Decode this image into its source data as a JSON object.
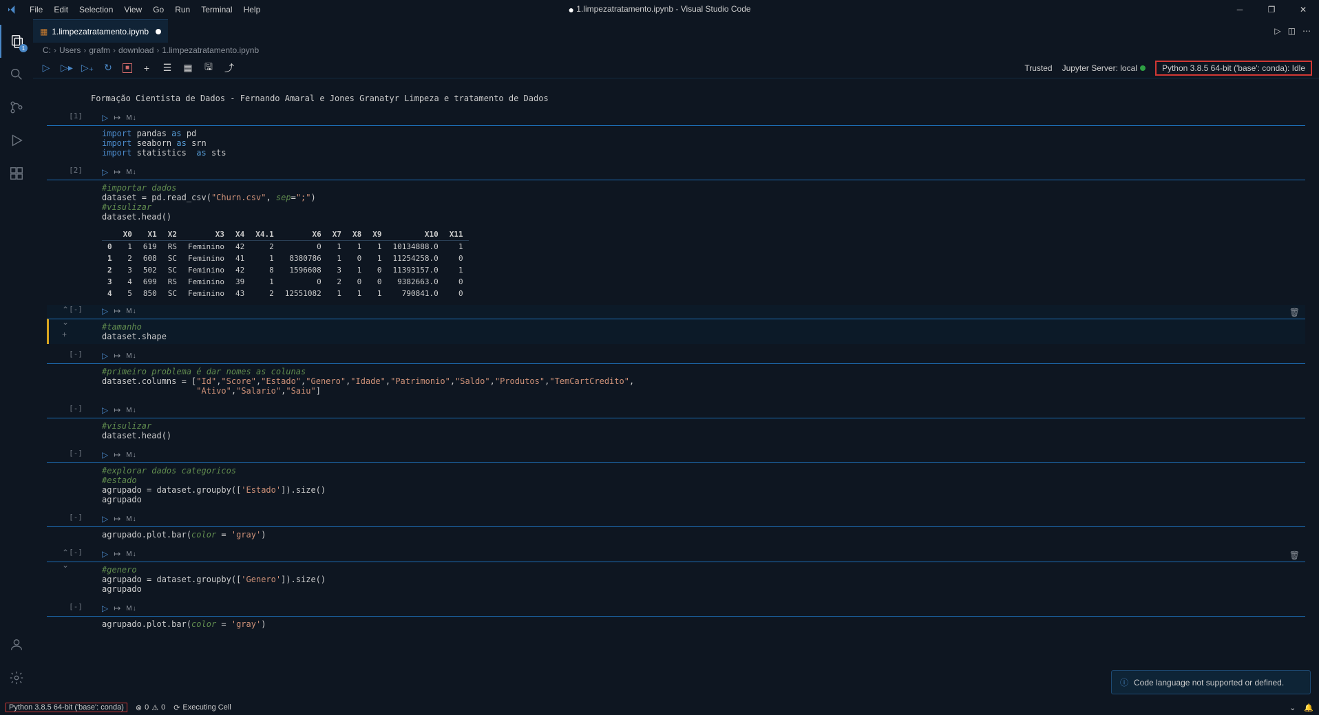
{
  "menu": [
    "File",
    "Edit",
    "Selection",
    "View",
    "Go",
    "Run",
    "Terminal",
    "Help"
  ],
  "title": {
    "filename": "1.limpezatratamento.ipynb",
    "app": "Visual Studio Code"
  },
  "tab": {
    "label": "1.limpezatratamento.ipynb"
  },
  "breadcrumbs": [
    "C:",
    "Users",
    "grafm",
    "download",
    "1.limpezatratamento.ipynb"
  ],
  "nb_right": {
    "trusted": "Trusted",
    "jupyter": "Jupyter Server: local",
    "kernel": "Python 3.8.5 64-bit ('base': conda): Idle"
  },
  "markdown": "Formação Cientista de Dados - Fernando Amaral e Jones Granatyr Limpeza e tratamento de Dados",
  "cells": [
    {
      "prompt": "[1]",
      "lang": "M↓",
      "code_html": "<span class='kw'>import</span> pandas <span class='op'>as</span> pd\n<span class='kw'>import</span> seaborn <span class='op'>as</span> srn\n<span class='kw'>import</span> statistics  <span class='op'>as</span> sts"
    },
    {
      "prompt": "[2]",
      "lang": "M↓",
      "code_html": "<span class='cm'>#importar dados</span>\ndataset = pd.read_csv(<span class='st'>\"Churn.csv\"</span>, <span class='cm'>sep</span>=<span class='st'>\";\"</span>)\n<span class='cm'>#visulizar</span>\ndataset.head()",
      "table": {
        "headers": [
          "",
          "X0",
          "X1",
          "X2",
          "X3",
          "X4",
          "X4.1",
          "X6",
          "X7",
          "X8",
          "X9",
          "X10",
          "X11"
        ],
        "rows": [
          [
            "0",
            "1",
            "619",
            "RS",
            "Feminino",
            "42",
            "2",
            "0",
            "1",
            "1",
            "1",
            "10134888.0",
            "1"
          ],
          [
            "1",
            "2",
            "608",
            "SC",
            "Feminino",
            "41",
            "1",
            "8380786",
            "1",
            "0",
            "1",
            "11254258.0",
            "0"
          ],
          [
            "2",
            "3",
            "502",
            "SC",
            "Feminino",
            "42",
            "8",
            "1596608",
            "3",
            "1",
            "0",
            "11393157.0",
            "1"
          ],
          [
            "3",
            "4",
            "699",
            "RS",
            "Feminino",
            "39",
            "1",
            "0",
            "2",
            "0",
            "0",
            "9382663.0",
            "0"
          ],
          [
            "4",
            "5",
            "850",
            "SC",
            "Feminino",
            "43",
            "2",
            "12551082",
            "1",
            "1",
            "1",
            "790841.0",
            "0"
          ]
        ]
      }
    },
    {
      "prompt": "[-]",
      "lang": "M↓",
      "active": true,
      "code_html": "<span class='cm'>#tamanho</span>\ndataset.shape"
    },
    {
      "prompt": "[-]",
      "lang": "M↓",
      "code_html": "<span class='cm'>#primeiro problema é dar nomes as colunas</span>\ndataset.columns = [<span class='st'>\"Id\"</span>,<span class='st'>\"Score\"</span>,<span class='st'>\"Estado\"</span>,<span class='st'>\"Genero\"</span>,<span class='st'>\"Idade\"</span>,<span class='st'>\"Patrimonio\"</span>,<span class='st'>\"Saldo\"</span>,<span class='st'>\"Produtos\"</span>,<span class='st'>\"TemCartCredito\"</span>,\n                   <span class='st'>\"Ativo\"</span>,<span class='st'>\"Salario\"</span>,<span class='st'>\"Saiu\"</span>]"
    },
    {
      "prompt": "[-]",
      "lang": "M↓",
      "code_html": "<span class='cm'>#visulizar</span>\ndataset.head()"
    },
    {
      "prompt": "[-]",
      "lang": "M↓",
      "code_html": "<span class='cm'>#explorar dados categoricos</span>\n<span class='cm'>#estado</span>\nagrupado = dataset.groupby([<span class='st'>'Estado'</span>]).size()\nagrupado"
    },
    {
      "prompt": "[-]",
      "lang": "M↓",
      "code_html": "agrupado.plot.bar(<span class='cm'>color</span> = <span class='st'>'gray'</span>)"
    },
    {
      "prompt": "[-]",
      "lang": "M↓",
      "code_html": "<span class='cm'>#genero</span>\nagrupado = dataset.groupby([<span class='st'>'Genero'</span>]).size()\nagrupado",
      "sidebtns": true
    },
    {
      "prompt": "[-]",
      "lang": "M↓",
      "code_html": "agrupado.plot.bar(<span class='cm'>color</span> = <span class='st'>'gray'</span>)"
    }
  ],
  "notification": "Code language not supported or defined.",
  "status": {
    "kernel": "Python 3.8.5 64-bit ('base': conda)",
    "errors": "0",
    "warnings": "0",
    "executing": "Executing Cell",
    "sync": "⟳"
  }
}
